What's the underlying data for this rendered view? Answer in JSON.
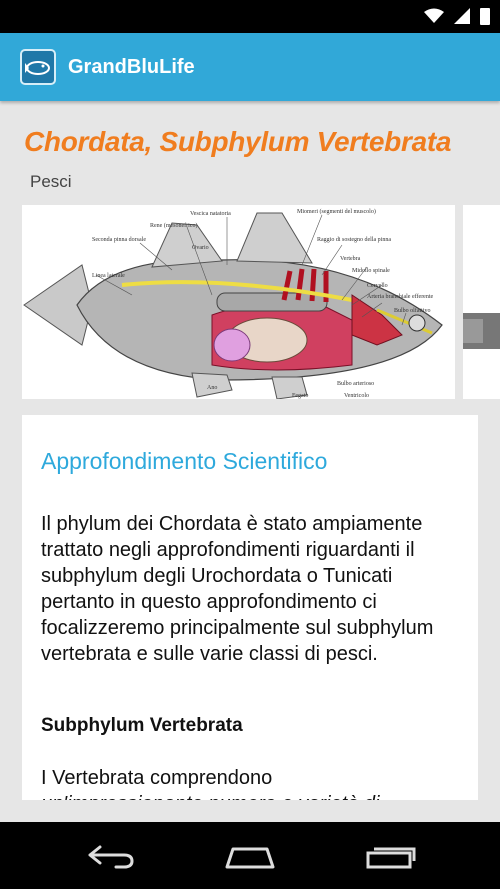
{
  "app": {
    "title": "GrandBluLife",
    "icon": "grandblulife-logo-icon"
  },
  "page": {
    "title": "Chordata, Subphylum Vertebrata",
    "subtitle": "Pesci"
  },
  "gallery": {
    "images": [
      {
        "name": "fish-anatomy-diagram",
        "labels": [
          "Vescica natatoria",
          "Miomeri (segmenti del muscolo)",
          "Rene (mesonefrico)",
          "Raggio di sostegno della pinna",
          "Seconda pinna dorsale",
          "Ovario",
          "Vertebra",
          "Midollo spinale",
          "Linea laterale",
          "Cervello",
          "Arteria branchiale efferente",
          "Bulbo olfattivo",
          "Bulbo arterioso",
          "Ano",
          "Fegato",
          "Ventricolo"
        ]
      },
      {
        "name": "second-gallery-image"
      }
    ]
  },
  "card": {
    "heading": "Approfondimento Scientifico",
    "paragraph": "Il phylum dei Chordata è stato ampiamente trattato negli approfondimenti riguardanti il subphylum degli Urochordata o Tunicati pertanto in questo approfondimento ci focalizzeremo principalmente sul subphylum vertebrata e sulle varie classi di pesci.",
    "subheading": "Subphylum Vertebrata",
    "paragraph2": "I Vertebrata comprendono",
    "paragraph3_partial": "un'impressionante numero e varietà di"
  },
  "navbar": {
    "back": "back-icon",
    "home": "home-icon",
    "recents": "recents-icon"
  },
  "colors": {
    "actionbar": "#31a8d8",
    "title": "#f07d1f",
    "heading": "#2ea9dc"
  }
}
